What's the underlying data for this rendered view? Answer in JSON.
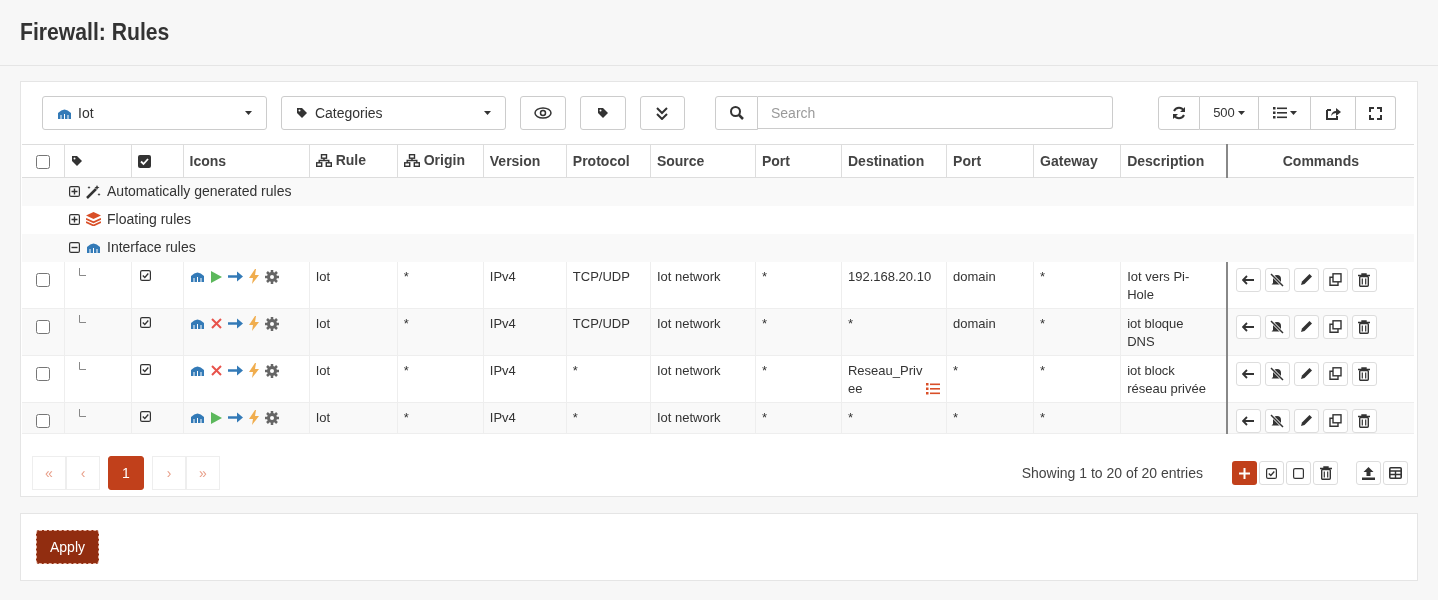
{
  "page_title": "Firewall: Rules",
  "toolbar": {
    "interface": "Iot",
    "categories": "Categories",
    "search": {
      "placeholder": "Search"
    },
    "page_size": "500"
  },
  "select_all": {
    "checked": false
  },
  "columns": [
    "",
    "",
    "",
    "Icons",
    "Rule",
    "Origin",
    "Version",
    "Protocol",
    "Source",
    "Port",
    "Destination",
    "Port",
    "Gateway",
    "Description",
    "Commands"
  ],
  "groups": [
    {
      "kind": "auto",
      "label": "Automatically generated rules",
      "expanded": false
    },
    {
      "kind": "floating",
      "label": "Floating rules",
      "expanded": false
    },
    {
      "kind": "interface",
      "label": "Interface rules",
      "expanded": true
    }
  ],
  "rules": [
    {
      "selected": false,
      "enabled": true,
      "kind": "pass",
      "rule": "Iot",
      "origin": "*",
      "version": "IPv4",
      "protocol": "TCP/UDP",
      "source": "Iot network",
      "source_port": "*",
      "destination": "192.168.20.10",
      "destination_alias": false,
      "destination_port": "domain",
      "gateway": "*",
      "description": "Iot vers Pi-Hole"
    },
    {
      "selected": false,
      "enabled": true,
      "kind": "block",
      "rule": "Iot",
      "origin": "*",
      "version": "IPv4",
      "protocol": "TCP/UDP",
      "source": "Iot network",
      "source_port": "*",
      "destination": "*",
      "destination_alias": false,
      "destination_port": "domain",
      "gateway": "*",
      "description": "iot bloque DNS"
    },
    {
      "selected": false,
      "enabled": true,
      "kind": "block",
      "rule": "Iot",
      "origin": "*",
      "version": "IPv4",
      "protocol": "*",
      "source": "Iot network",
      "source_port": "*",
      "destination": "Reseau_Privee",
      "destination_alias": true,
      "destination_port": "*",
      "gateway": "*",
      "description": "iot block réseau privée"
    },
    {
      "selected": false,
      "enabled": true,
      "kind": "pass",
      "rule": "Iot",
      "origin": "*",
      "version": "IPv4",
      "protocol": "*",
      "source": "Iot network",
      "source_port": "*",
      "destination": "*",
      "destination_alias": false,
      "destination_port": "*",
      "gateway": "*"
    }
  ],
  "pagination": [
    {
      "label": "«",
      "selected": false
    },
    {
      "label": "‹",
      "selected": false
    },
    {
      "label": "1",
      "selected": true
    },
    {
      "label": "›",
      "selected": false
    },
    {
      "label": "»",
      "selected": false
    }
  ],
  "footer_text": "Showing 1 to 20 of 20 entries",
  "apply_button": "Apply"
}
